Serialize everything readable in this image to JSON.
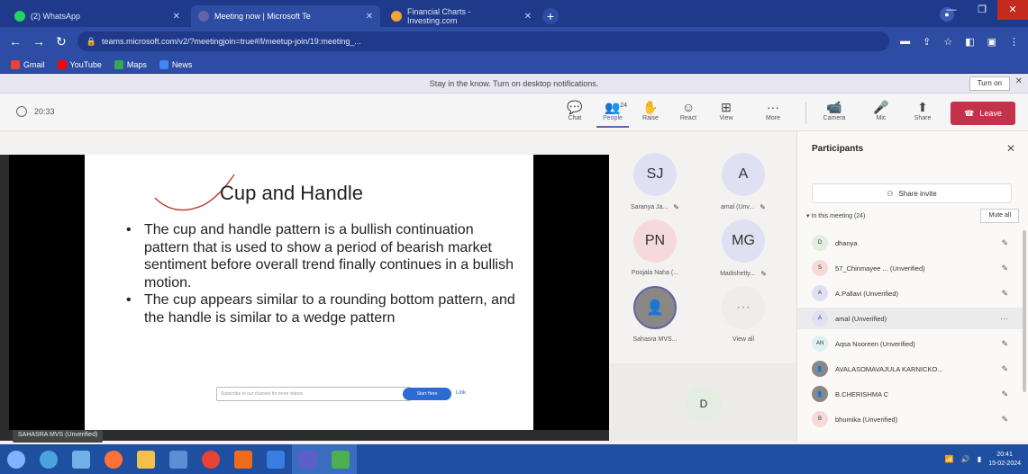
{
  "browser": {
    "tabs": [
      {
        "label": "(2) WhatsApp",
        "color": "#25d366",
        "active": false
      },
      {
        "label": "Meeting now | Microsoft Te",
        "color": "#6264a7",
        "active": true
      },
      {
        "label": "Financial Charts - Investing.com",
        "color": "#f1a33a",
        "active": false
      }
    ],
    "new_tab": "+",
    "address": "teams.microsoft.com/v2/?meetingjoin=true#/l/meetup-join/19:meeting_...",
    "address_domain": "teams.microsoft.com",
    "bookmarks": [
      {
        "label": "Gmail",
        "color": "#ea4335"
      },
      {
        "label": "YouTube",
        "color": "#ff0000"
      },
      {
        "label": "Maps",
        "color": "#34a853"
      },
      {
        "label": "News",
        "color": "#4285f4"
      }
    ]
  },
  "notice": {
    "text": "Stay in the know. Turn on desktop notifications.",
    "button": "Turn on",
    "close": "✕"
  },
  "toolbar": {
    "timer": "20:33",
    "buttons": [
      {
        "label": "Chat",
        "glyph": "💬"
      },
      {
        "label": "People",
        "glyph": "👥",
        "count": "24",
        "selected": true
      },
      {
        "label": "Raise",
        "glyph": "✋"
      },
      {
        "label": "React",
        "glyph": "☺"
      },
      {
        "label": "View",
        "glyph": "⊞"
      },
      {
        "label": "More",
        "glyph": "···"
      },
      {
        "label": "Camera",
        "glyph": "📹"
      },
      {
        "label": "Mic",
        "glyph": "🎤"
      },
      {
        "label": "Share",
        "glyph": "⬆"
      }
    ],
    "leave": "Leave",
    "leave_color": "#c4314b"
  },
  "slide": {
    "title": "Cup and Handle",
    "bullets": [
      "The cup and handle pattern is a bullish continuation pattern that is used to show a period of bearish market sentiment before overall trend finally continues in a bullish motion.",
      "The cup appears similar to a rounding bottom pattern, and the handle is similar to a wedge pattern"
    ],
    "bar_text": "Subscribe to our channel for more videos",
    "bar_button": "Start Here",
    "bar_link": "Link"
  },
  "presenter_label": "SAHASRA MVS (Unverified)",
  "gallery": [
    {
      "initials": "SJ",
      "name": "Saranya Ja...",
      "bg": "#dfe1f3"
    },
    {
      "initials": "A",
      "name": "amal (Unv...",
      "bg": "#dfe1f3"
    },
    {
      "initials": "PN",
      "name": "Poojala Naha (...",
      "bg": "#f6dada"
    },
    {
      "initials": "MG",
      "name": "Madishetty...",
      "bg": "#dfe1f3"
    },
    {
      "initials": "👤",
      "name": "Sahasra MVS...",
      "bg": "#8a8886"
    },
    {
      "initials": "···",
      "name": "View all",
      "bg": "#eeedec"
    }
  ],
  "gallery_bottom": "D",
  "participants": {
    "title": "Participants",
    "share_invite": "Share invite",
    "in_meeting": "In this meeting (24)",
    "mute_all": "Mute all",
    "list": [
      {
        "initials": "D",
        "name": "dhanya",
        "bg": "#e2efe0"
      },
      {
        "initials": "S",
        "name": "57_Chinmayee ... (Unverified)",
        "bg": "#f6dada"
      },
      {
        "initials": "A",
        "name": "A.Pallavi (Unverified)",
        "bg": "#dfe1f3"
      },
      {
        "initials": "A",
        "name": "amal (Unverified)",
        "bg": "#dfe1f3",
        "hover": true
      },
      {
        "initials": "AN",
        "name": "Aqsa Nooreen (Unverified)",
        "bg": "#dff1f0"
      },
      {
        "initials": "👤",
        "name": "AVALASOMAVAJULA KARNICKO...",
        "bg": "#8a8886"
      },
      {
        "initials": "👤",
        "name": "B.CHERISHMA C",
        "bg": "#8a8886"
      },
      {
        "initials": "B",
        "name": "bhumika (Unverified)",
        "bg": "#f6dada"
      }
    ]
  },
  "taskbar": {
    "apps": [
      {
        "name": "start",
        "color": "#7fb3ff"
      },
      {
        "name": "edge",
        "color": "#4aa3df"
      },
      {
        "name": "files",
        "color": "#6fb0e8"
      },
      {
        "name": "firefox",
        "color": "#ff7139"
      },
      {
        "name": "explorer",
        "color": "#f3c14b"
      },
      {
        "name": "store",
        "color": "#5a8fd6"
      },
      {
        "name": "chrome",
        "color": "#e94335"
      },
      {
        "name": "media",
        "color": "#f06a1b"
      },
      {
        "name": "app",
        "color": "#3a7de0"
      },
      {
        "name": "teams",
        "color": "#5b5fc7"
      },
      {
        "name": "green",
        "color": "#4caf50"
      }
    ],
    "time": "20:41",
    "date": "15-02-2024"
  }
}
